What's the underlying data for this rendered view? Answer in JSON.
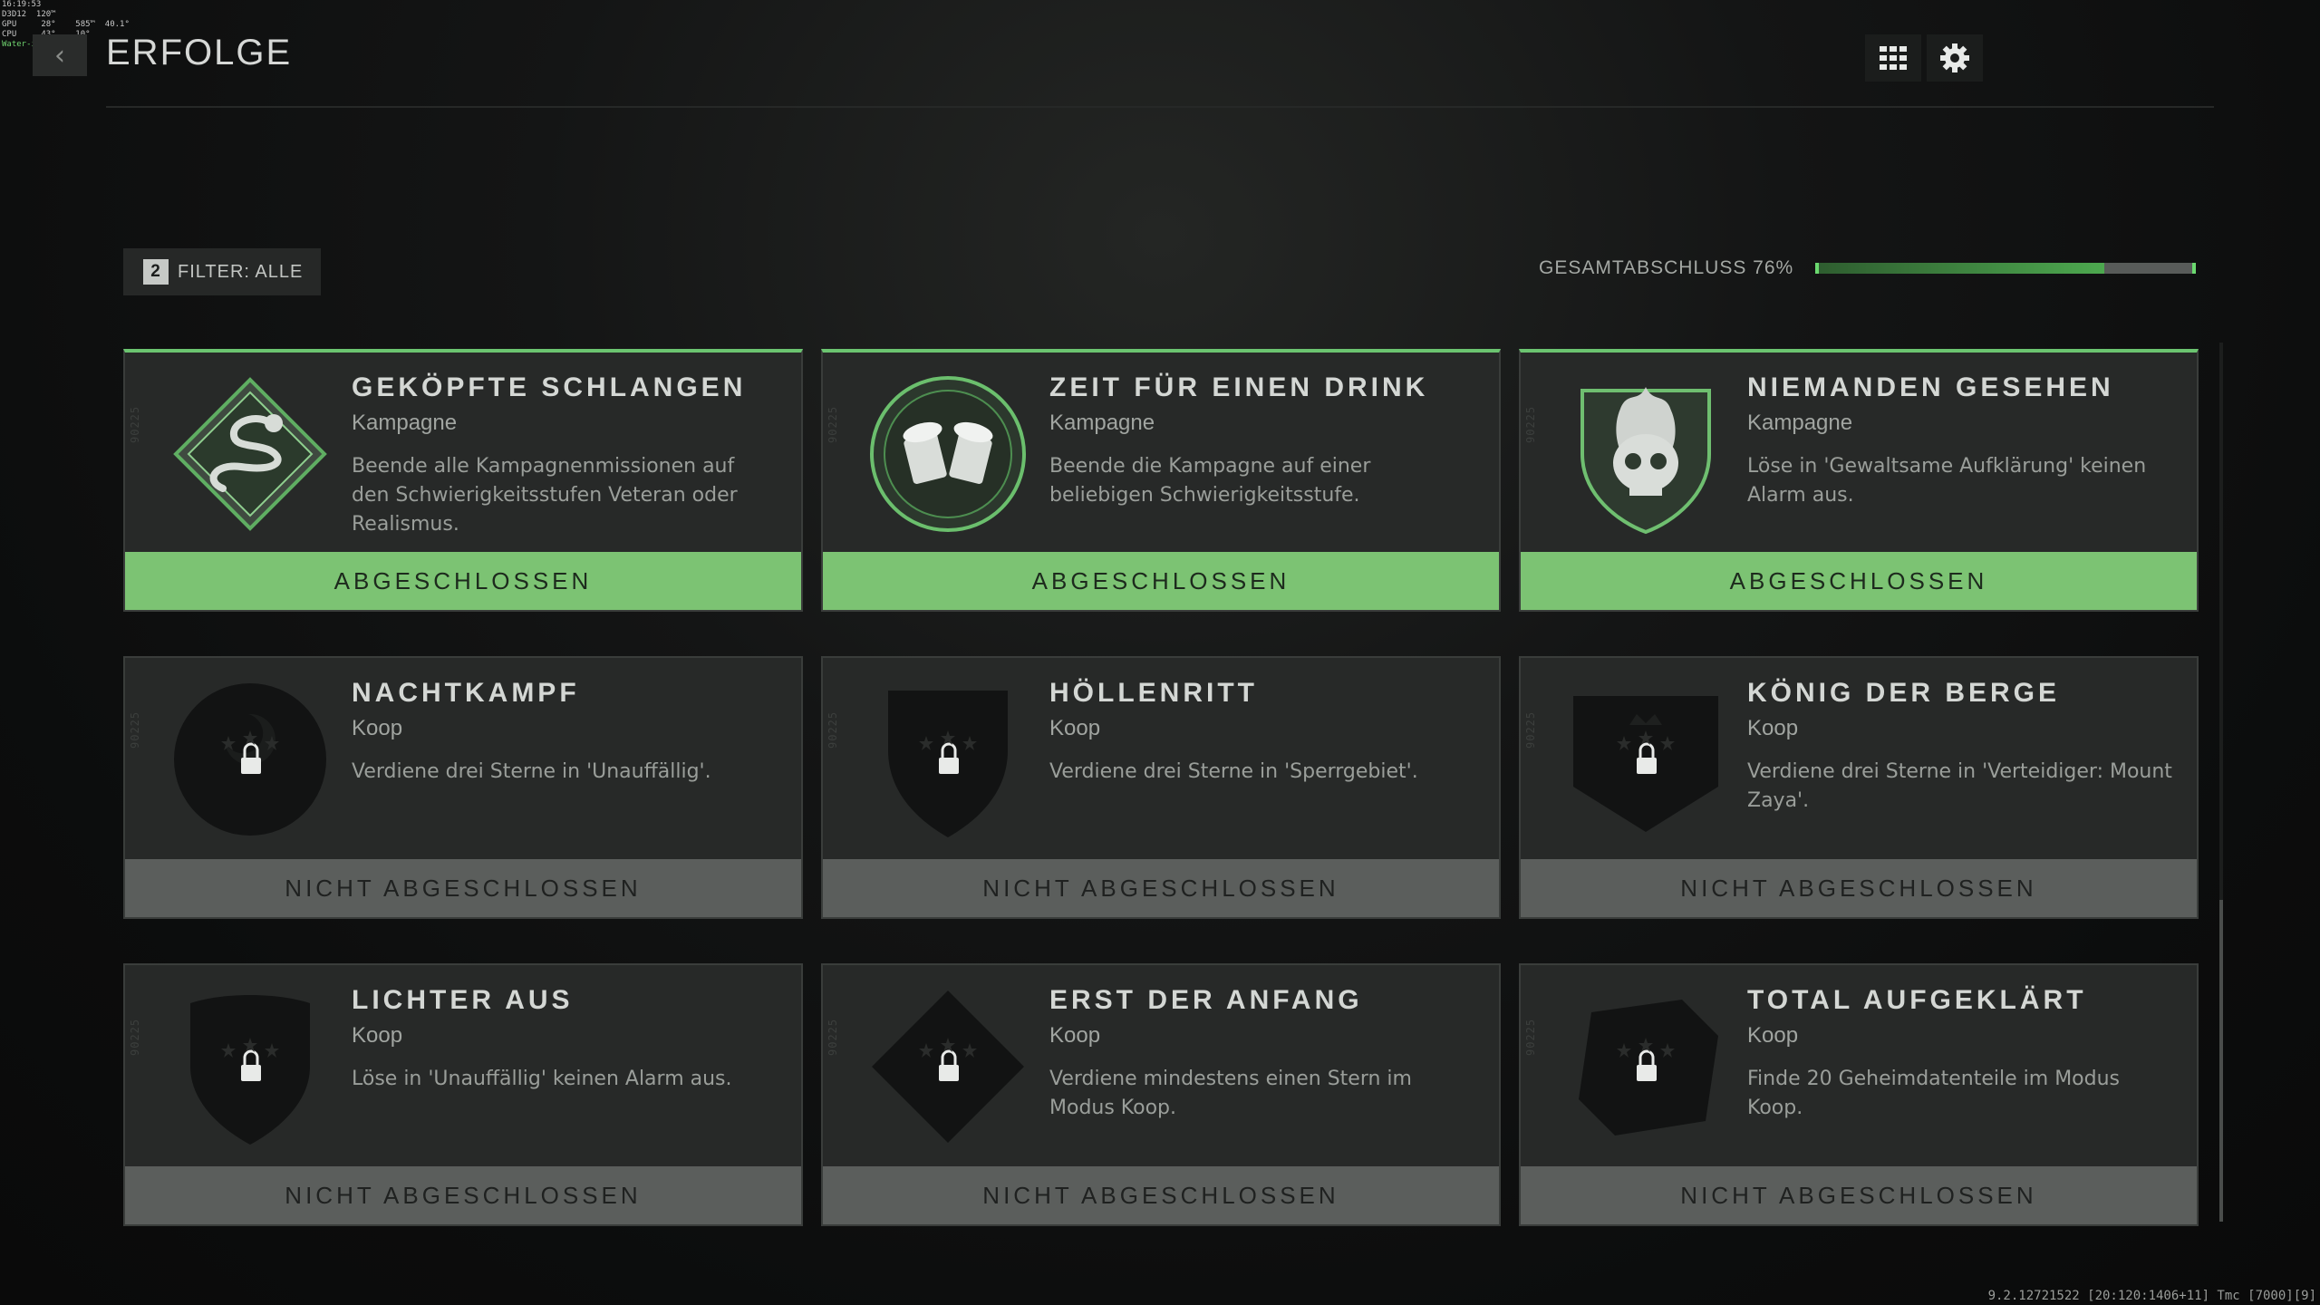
{
  "overlay": {
    "line1": "16:19:53",
    "line2": "D3D12  120™",
    "line3": "GPU     28°    585™  40.1°",
    "line4": "CPU     43°    10°",
    "line5": "Water-in: 28.3 °C"
  },
  "header": {
    "back_glyph": "‹",
    "title": "ERFOLGE",
    "grid_icon": "grid-icon",
    "settings_icon": "gear-icon"
  },
  "filter": {
    "count": "2",
    "label": "FILTER: ALLE"
  },
  "progress": {
    "label": "GESAMTABSCHLUSS 76%",
    "percent": 76,
    "fill_color": "#4da84f",
    "accent_color": "#6bd96f"
  },
  "scrollbar": {
    "position_fraction": 0.63
  },
  "achievements": [
    {
      "title": "GEKÖPFTE SCHLANGEN",
      "category": "Kampagne",
      "description": "Beende alle Kampagnenmissionen auf den Schwierigkeitsstufen Veteran oder Realismus.",
      "status": "ABGESCHLOSSEN",
      "completed": true,
      "icon": "snake-emblem-icon",
      "side_code": "90225"
    },
    {
      "title": "ZEIT FÜR EINEN DRINK",
      "category": "Kampagne",
      "description": "Beende die Kampagne auf einer beliebigen Schwierigkeitsstufe.",
      "status": "ABGESCHLOSSEN",
      "completed": true,
      "icon": "beer-mugs-emblem-icon",
      "side_code": "90225"
    },
    {
      "title": "NIEMANDEN GESEHEN",
      "category": "Kampagne",
      "description": "Löse in 'Gewaltsame Aufklärung' keinen Alarm aus.",
      "status": "ABGESCHLOSSEN",
      "completed": true,
      "icon": "flaming-skull-emblem-icon",
      "side_code": "90225"
    },
    {
      "title": "NACHTKAMPF",
      "category": "Koop",
      "description": "Verdiene drei Sterne in 'Unauffällig'.",
      "status": "NICHT ABGESCHLOSSEN",
      "completed": false,
      "icon": "locked-moon-emblem-icon",
      "side_code": "90225"
    },
    {
      "title": "HÖLLENRITT",
      "category": "Koop",
      "description": "Verdiene drei Sterne in 'Sperrgebiet'.",
      "status": "NICHT ABGESCHLOSSEN",
      "completed": false,
      "icon": "locked-shield-emblem-icon",
      "side_code": "90225"
    },
    {
      "title": "KÖNIG DER BERGE",
      "category": "Koop",
      "description": "Verdiene drei Sterne in 'Verteidiger: Mount Zaya'.",
      "status": "NICHT ABGESCHLOSSEN",
      "completed": false,
      "icon": "locked-crown-emblem-icon",
      "side_code": "90225"
    },
    {
      "title": "LICHTER AUS",
      "category": "Koop",
      "description": "Löse in 'Unauffällig' keinen Alarm aus.",
      "status": "NICHT ABGESCHLOSSEN",
      "completed": false,
      "icon": "locked-stars-emblem-icon",
      "side_code": "90225"
    },
    {
      "title": "ERST DER ANFANG",
      "category": "Koop",
      "description": "Verdiene mindestens einen Stern im Modus Koop.",
      "status": "NICHT ABGESCHLOSSEN",
      "completed": false,
      "icon": "locked-diamond-emblem-icon",
      "side_code": "90225"
    },
    {
      "title": "TOTAL AUFGEKLÄRT",
      "category": "Koop",
      "description": "Finde 20 Geheimdatenteile im Modus Koop.",
      "status": "NICHT ABGESCHLOSSEN",
      "completed": false,
      "icon": "locked-disk-emblem-icon",
      "side_code": "90225"
    }
  ],
  "footer": {
    "build": "9.2.12721522 [20:120:1406+11] Tmc [7000][9]"
  }
}
